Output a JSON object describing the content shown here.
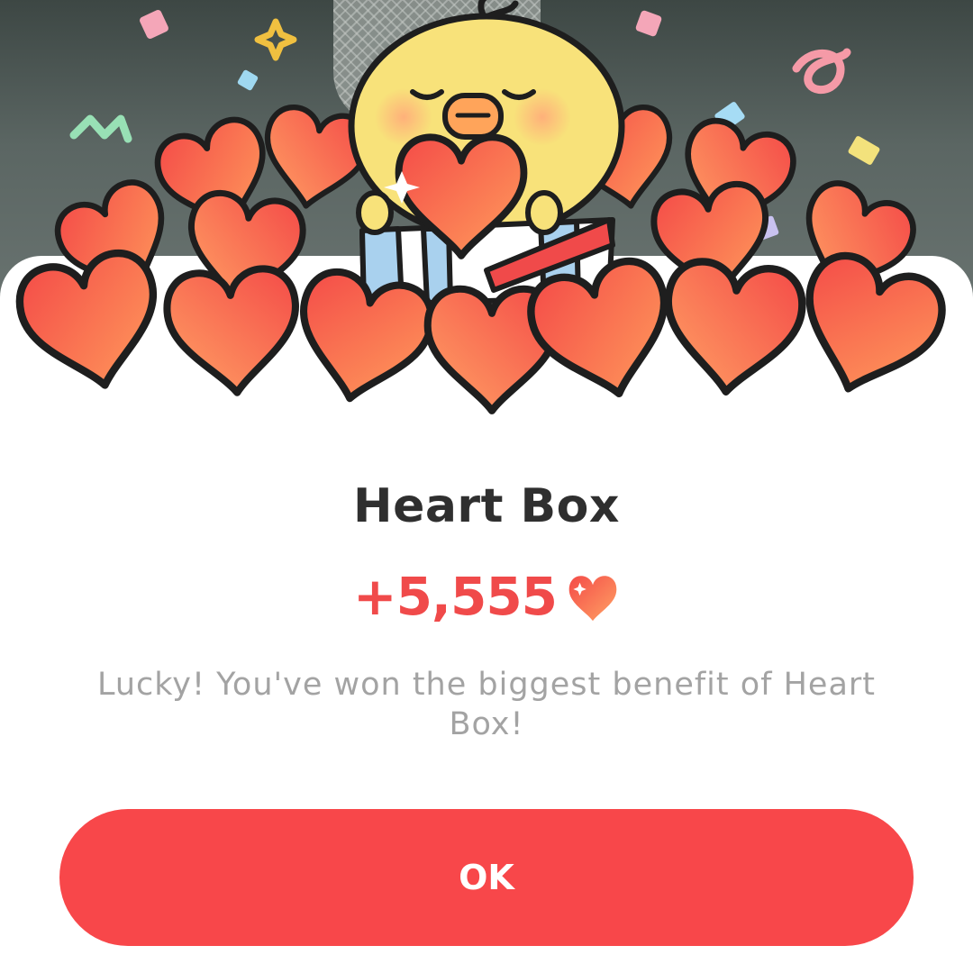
{
  "dialog": {
    "title": "Heart Box",
    "reward_amount": "+5,555",
    "reward_icon": "heart-icon",
    "message": "Lucky! You've won the biggest benefit of Heart Box!",
    "ok_label": "OK"
  },
  "colors": {
    "accent": "#f8474a",
    "reward_text": "#f04a4a",
    "title_text": "#2f2f2f",
    "message_text": "#a3a3a3",
    "heart_light": "#ff9d5c",
    "heart_dark": "#f44b48",
    "chick": "#f8e27a",
    "background": "#ffffff"
  }
}
